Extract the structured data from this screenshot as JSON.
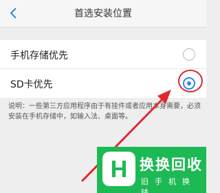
{
  "header": {
    "back_icon": "chevron-left-icon",
    "title": "首选安装位置"
  },
  "options": [
    {
      "label": "手机存储优先",
      "selected": false
    },
    {
      "label": "SD卡优先",
      "selected": true
    }
  ],
  "description": "说明：一些第三方应用程序由于有挂件或者应用本身需要，必须安装在手机存储中，如输入法、桌面等。",
  "watermark": {
    "logo_icon": "h-logo-icon",
    "title": "换换回收",
    "subtitle": "旧手机换钱"
  },
  "colors": {
    "accent": "#2a86e8",
    "annotation_red": "#e0272b",
    "watermark_green": "#1db954"
  }
}
